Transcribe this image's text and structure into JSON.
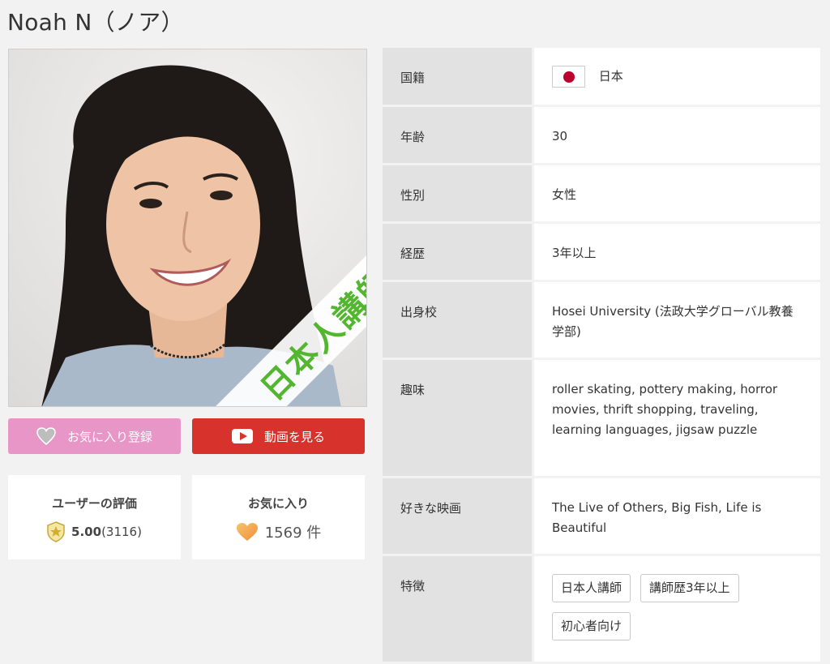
{
  "teacher": {
    "name": "Noah N（ノア）"
  },
  "photo": {
    "badge_text": "日本人講師"
  },
  "actions": {
    "favorite_label": "お気に入り登録",
    "video_label": "動画を見る"
  },
  "stats": {
    "rating_label": "ユーザーの評価",
    "rating_value": "5.00",
    "rating_count": "(3116)",
    "favorites_label": "お気に入り",
    "favorites_count": "1569 件"
  },
  "profile": {
    "rows": [
      {
        "key": "国籍",
        "value": "日本"
      },
      {
        "key": "年齢",
        "value": "30"
      },
      {
        "key": "性別",
        "value": "女性"
      },
      {
        "key": "経歴",
        "value": "3年以上"
      },
      {
        "key": "出身校",
        "value": "Hosei University (法政大学グローバル教養学部)"
      },
      {
        "key": "趣味",
        "value": "roller skating, pottery making, horror movies, thrift shopping, traveling, learning languages, jigsaw puzzle"
      },
      {
        "key": "好きな映画",
        "value": "The Live of Others, Big Fish, Life is Beautiful"
      },
      {
        "key": "特徴",
        "tags": [
          "日本人講師",
          "講師歴3年以上",
          "初心者向け"
        ]
      }
    ]
  },
  "colors": {
    "favorite_button": "#e896c7",
    "video_button": "#d8322c",
    "badge_green": "#52b62e",
    "flag_red": "#bc002d",
    "heart_orange": "#f5a84a"
  },
  "icons": {
    "favorite_button": "heart-outline-icon",
    "video_button": "play-icon",
    "rating": "shield-star-icon",
    "favorites": "heart-icon"
  }
}
